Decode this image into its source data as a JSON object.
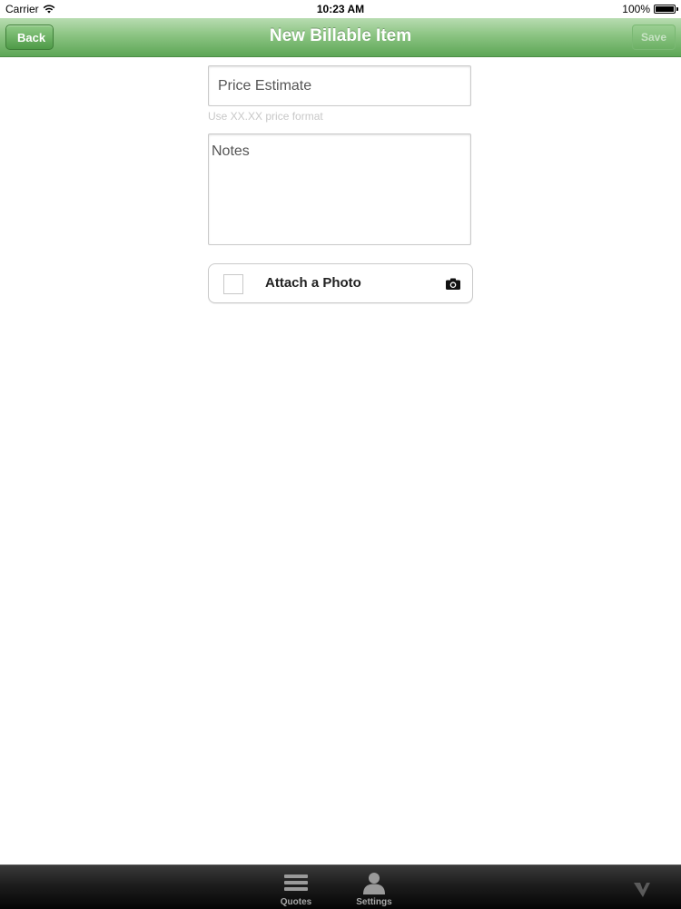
{
  "status_bar": {
    "carrier": "Carrier",
    "time": "10:23 AM",
    "battery": "100%",
    "wifi_icon": "wifi-icon",
    "battery_icon": "battery-icon"
  },
  "nav": {
    "title": "New Billable Item",
    "back_label": "Back",
    "save_label": "Save",
    "save_enabled": false,
    "bar_color": "#6fb467"
  },
  "form": {
    "price": {
      "placeholder": "Price Estimate",
      "value": "",
      "hint": "Use XX.XX price format"
    },
    "notes": {
      "placeholder": "Notes",
      "value": ""
    },
    "attach": {
      "label": "Attach a Photo",
      "checked": false,
      "icon": "camera-icon"
    }
  },
  "tab_bar": {
    "tabs": [
      {
        "label": "Quotes",
        "icon": "list-icon"
      },
      {
        "label": "Settings",
        "icon": "person-icon"
      }
    ],
    "logo_icon": "brand-logo-icon"
  }
}
